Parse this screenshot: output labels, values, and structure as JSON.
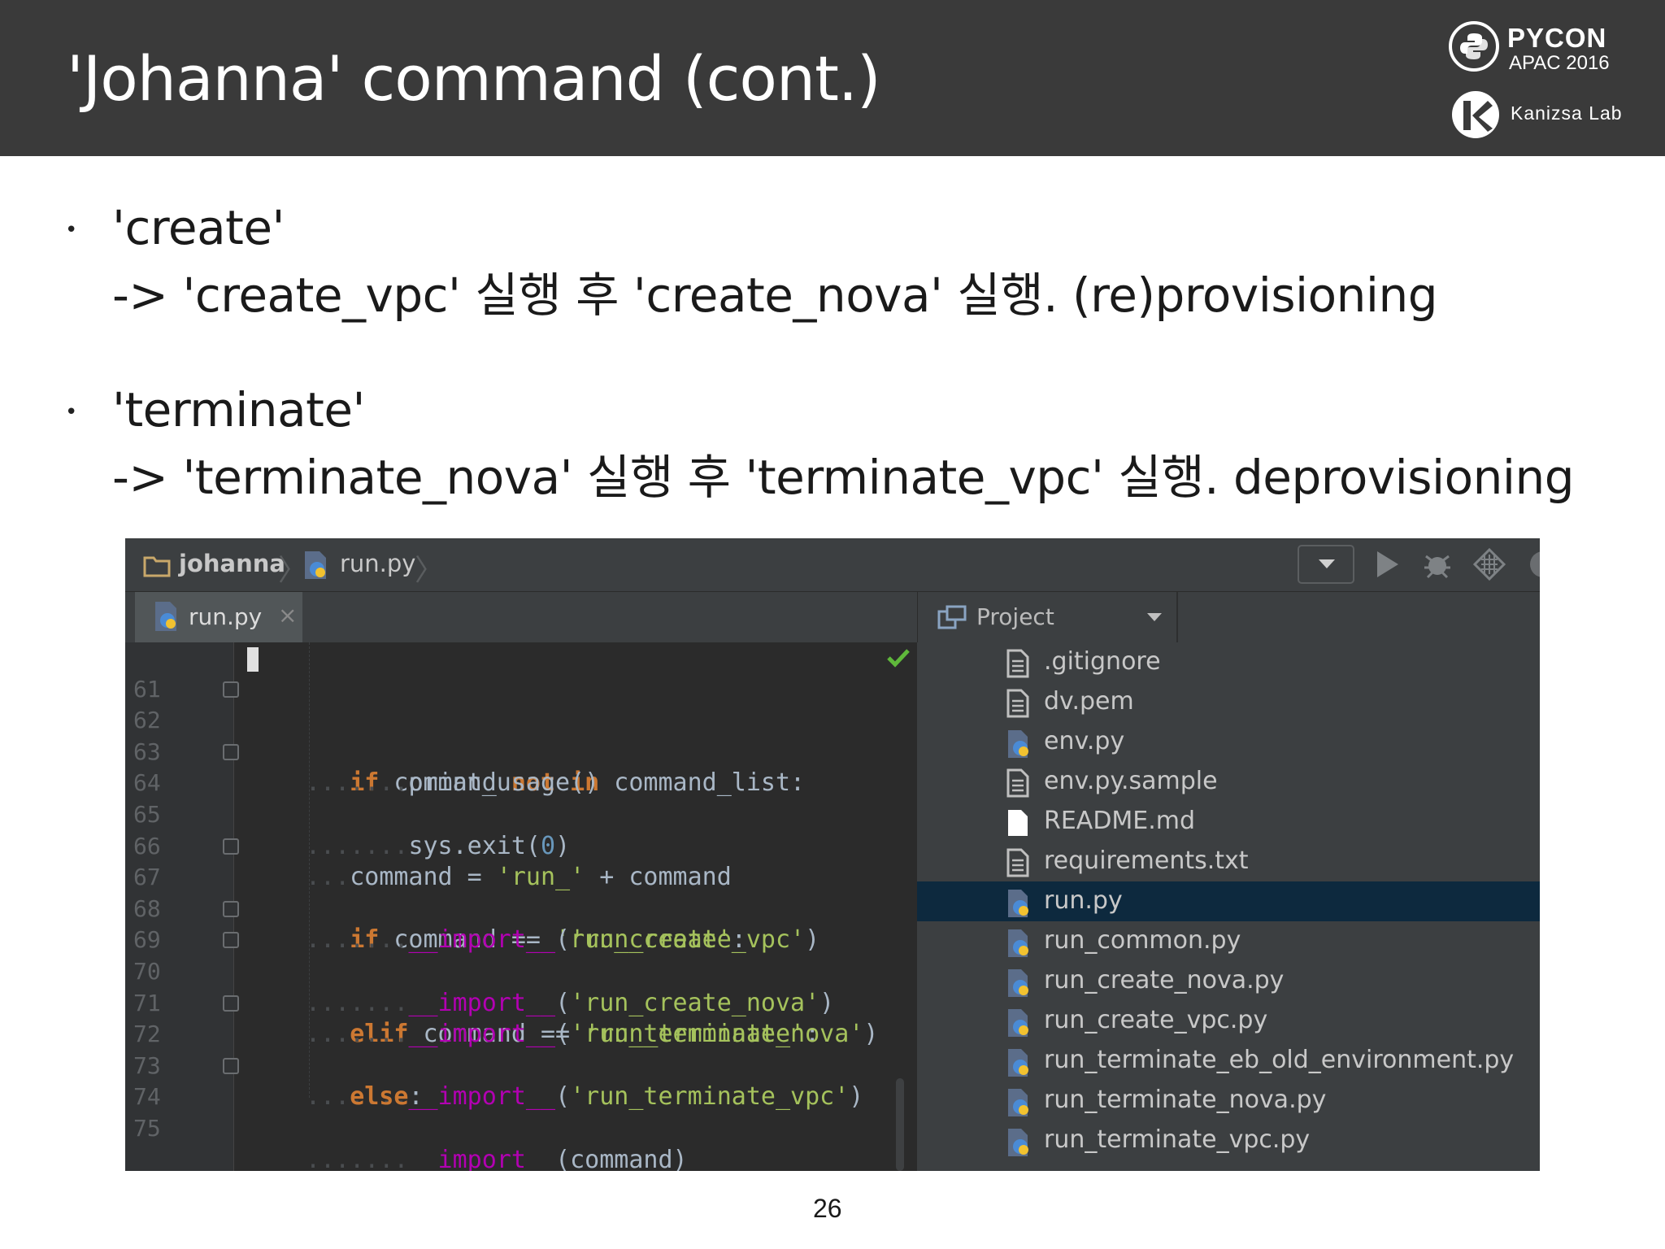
{
  "slide": {
    "title": "'Johanna' command (cont.)",
    "page_number": "26"
  },
  "logos": {
    "pycon_name": "PYCON",
    "pycon_sub": "APAC 2016",
    "kanizsa": "Kanizsa Lab"
  },
  "bullets": [
    {
      "marker": "•",
      "head": "'create'",
      "detail": "-> 'create_vpc' 실행 후 'create_nova' 실행. (re)provisioning"
    },
    {
      "marker": "•",
      "head": "'terminate'",
      "detail": "-> 'terminate_nova' 실행 후 'terminate_vpc' 실행. deprovisioning"
    }
  ],
  "ide": {
    "breadcrumb": [
      "johanna",
      "run.py"
    ],
    "active_tab": "run.py",
    "tab_close": "×",
    "project_label": "Project",
    "toolbar_icons": [
      "dropdown-icon",
      "run-icon",
      "debug-icon",
      "coverage-icon",
      "profile-icon"
    ],
    "line_numbers": [
      "61",
      "62",
      "63",
      "64",
      "65",
      "66",
      "67",
      "68",
      "69",
      "70",
      "71",
      "72",
      "73",
      "74",
      "75"
    ],
    "code_lines": [
      "",
      "if command not in command_list:",
      "    print_usage()",
      "    sys.exit(0)",
      "",
      "command = 'run_' + command",
      "if command == 'run_create':",
      "    __import__('run_create_vpc')",
      "    __import__('run_create_nova')",
      "elif command == 'run_terminate':",
      "    __import__('run_terminate_nova')",
      "    __import__('run_terminate_vpc')",
      "else:",
      "    __import__(command)",
      ""
    ],
    "files": [
      {
        "name": ".gitignore",
        "icon": "text-file-icon"
      },
      {
        "name": "dv.pem",
        "icon": "text-file-icon"
      },
      {
        "name": "env.py",
        "icon": "python-file-icon"
      },
      {
        "name": "env.py.sample",
        "icon": "text-file-icon"
      },
      {
        "name": "README.md",
        "icon": "markdown-file-icon"
      },
      {
        "name": "requirements.txt",
        "icon": "text-file-icon"
      },
      {
        "name": "run.py",
        "icon": "python-file-icon",
        "selected": true
      },
      {
        "name": "run_common.py",
        "icon": "python-file-icon"
      },
      {
        "name": "run_create_nova.py",
        "icon": "python-file-icon"
      },
      {
        "name": "run_create_vpc.py",
        "icon": "python-file-icon"
      },
      {
        "name": "run_terminate_eb_old_environment.py",
        "icon": "python-file-icon"
      },
      {
        "name": "run_terminate_nova.py",
        "icon": "python-file-icon"
      },
      {
        "name": "run_terminate_vpc.py",
        "icon": "python-file-icon"
      }
    ]
  },
  "colors": {
    "header_bg": "#3a3a3a",
    "editor_bg": "#2b2b2b",
    "panel_bg": "#3c3f41",
    "keyword": "#cc7832",
    "string": "#a5c25c",
    "selection": "#0d293e"
  }
}
